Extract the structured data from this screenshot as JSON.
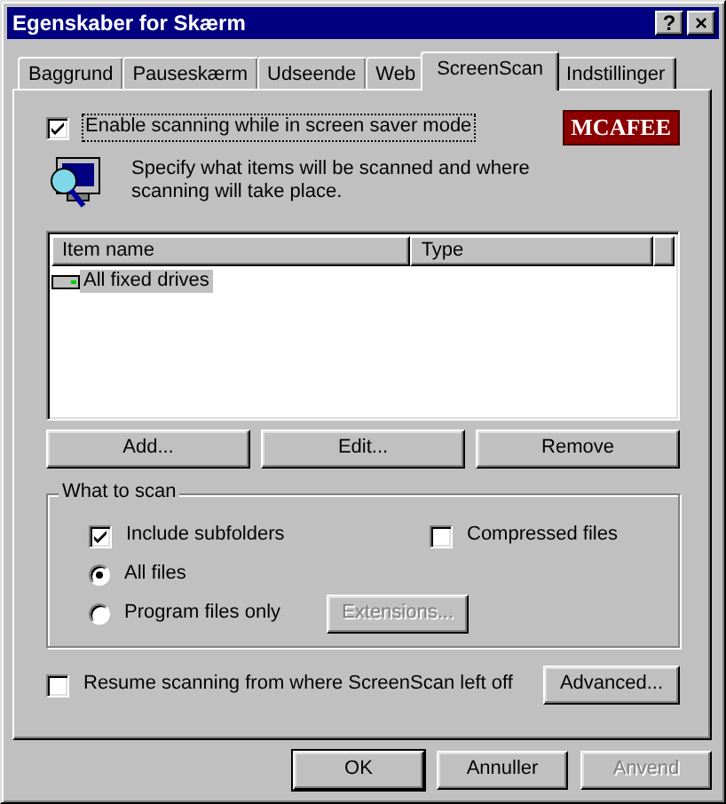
{
  "window": {
    "title": "Egenskaber for Skærm",
    "help_button": "?",
    "close_button": "×"
  },
  "tabs": [
    {
      "label": "Baggrund",
      "selected": false
    },
    {
      "label": "Pauseskærm",
      "selected": false
    },
    {
      "label": "Udseende",
      "selected": false
    },
    {
      "label": "Web",
      "selected": false
    },
    {
      "label": "ScreenScan",
      "selected": true
    },
    {
      "label": "Indstillinger",
      "selected": false
    }
  ],
  "enable_scanning": {
    "label": "Enable scanning while in screen saver mode",
    "checked": true
  },
  "logo": "MCAFEE",
  "description": "Specify what items will be scanned and where scanning will take place.",
  "items_list": {
    "columns": [
      "Item name",
      "Type"
    ],
    "rows": [
      {
        "name": "All fixed drives",
        "selected": true
      }
    ]
  },
  "list_buttons": [
    "Add...",
    "Edit...",
    "Remove"
  ],
  "what_to_scan": {
    "title": "What to scan",
    "checkboxes": [
      {
        "label": "Include subfolders",
        "checked": true
      },
      {
        "label": "Compressed files",
        "checked": false
      }
    ],
    "radios": [
      {
        "label": "All files",
        "selected": true
      },
      {
        "label": "Program files only",
        "selected": false
      }
    ],
    "extensions_button": {
      "label": "Extensions...",
      "disabled": true
    }
  },
  "resume": {
    "label": "Resume scanning from where ScreenScan left off",
    "checked": false
  },
  "advanced_button": "Advanced...",
  "dialog_buttons": [
    {
      "label": "OK",
      "default": true,
      "disabled": false
    },
    {
      "label": "Annuller",
      "default": false,
      "disabled": false
    },
    {
      "label": "Anvend",
      "default": false,
      "disabled": true
    }
  ]
}
